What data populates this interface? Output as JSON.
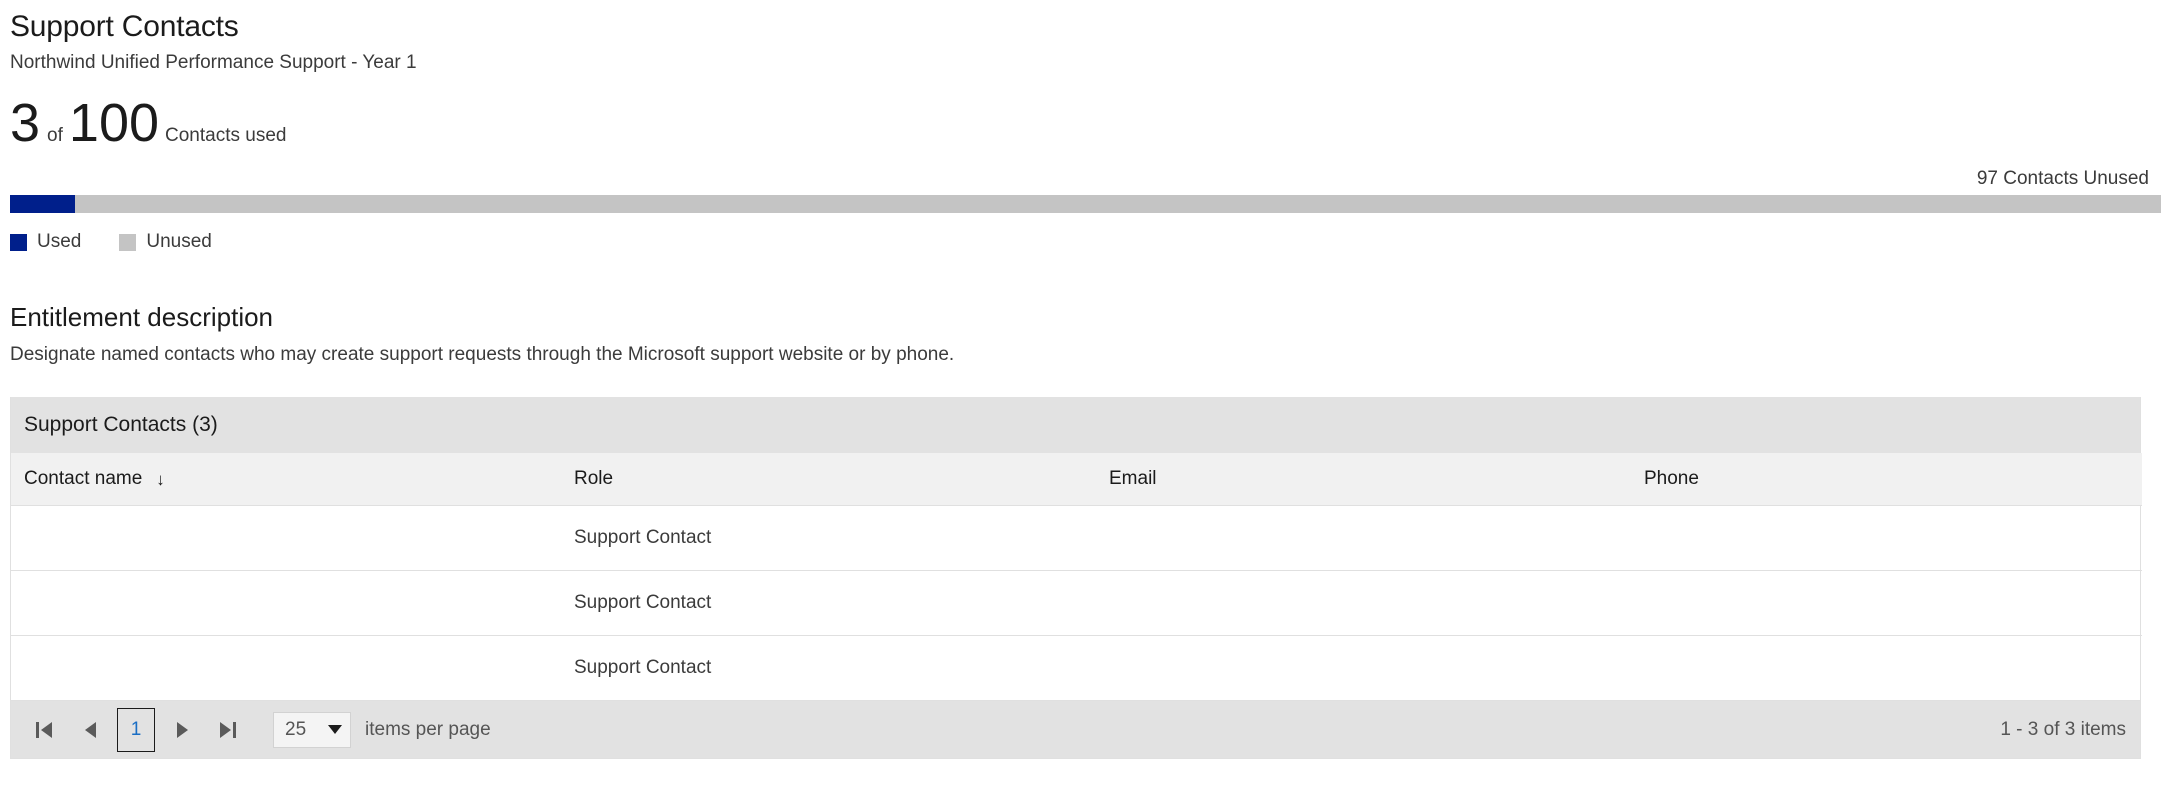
{
  "header": {
    "title": "Support Contacts",
    "subtitle": "Northwind Unified Performance Support - Year 1"
  },
  "usage": {
    "used": "3",
    "of": "of",
    "total": "100",
    "label": "Contacts used",
    "unused_caption": "97 Contacts Unused",
    "used_percent": 3,
    "used_color": "#001f8b",
    "unused_color": "#c4c4c4",
    "legend": [
      {
        "label": "Used",
        "color": "#001f8b",
        "swatch": "used"
      },
      {
        "label": "Unused",
        "color": "#c4c4c4",
        "swatch": "unused"
      }
    ]
  },
  "entitlement": {
    "title": "Entitlement description",
    "description": "Designate named contacts who may create support requests through the Microsoft support website or by phone."
  },
  "grid": {
    "toolbar_title": "Support Contacts (3)",
    "columns": [
      {
        "label": "Contact name",
        "sort": "↓"
      },
      {
        "label": "Role",
        "sort": ""
      },
      {
        "label": "Email",
        "sort": ""
      },
      {
        "label": "Phone",
        "sort": ""
      }
    ],
    "rows": [
      {
        "name": "",
        "role": "Support Contact",
        "email": "",
        "phone": ""
      },
      {
        "name": "",
        "role": "Support Contact",
        "email": "",
        "phone": ""
      },
      {
        "name": "",
        "role": "Support Contact",
        "email": "",
        "phone": ""
      }
    ]
  },
  "pager": {
    "first_icon": "go-to-first-page",
    "prev_icon": "go-to-previous-page",
    "current_page": "1",
    "next_icon": "go-to-next-page",
    "last_icon": "go-to-last-page",
    "page_size": "25",
    "page_size_label": "items per page",
    "range_info": "1 - 3 of 3 items"
  }
}
